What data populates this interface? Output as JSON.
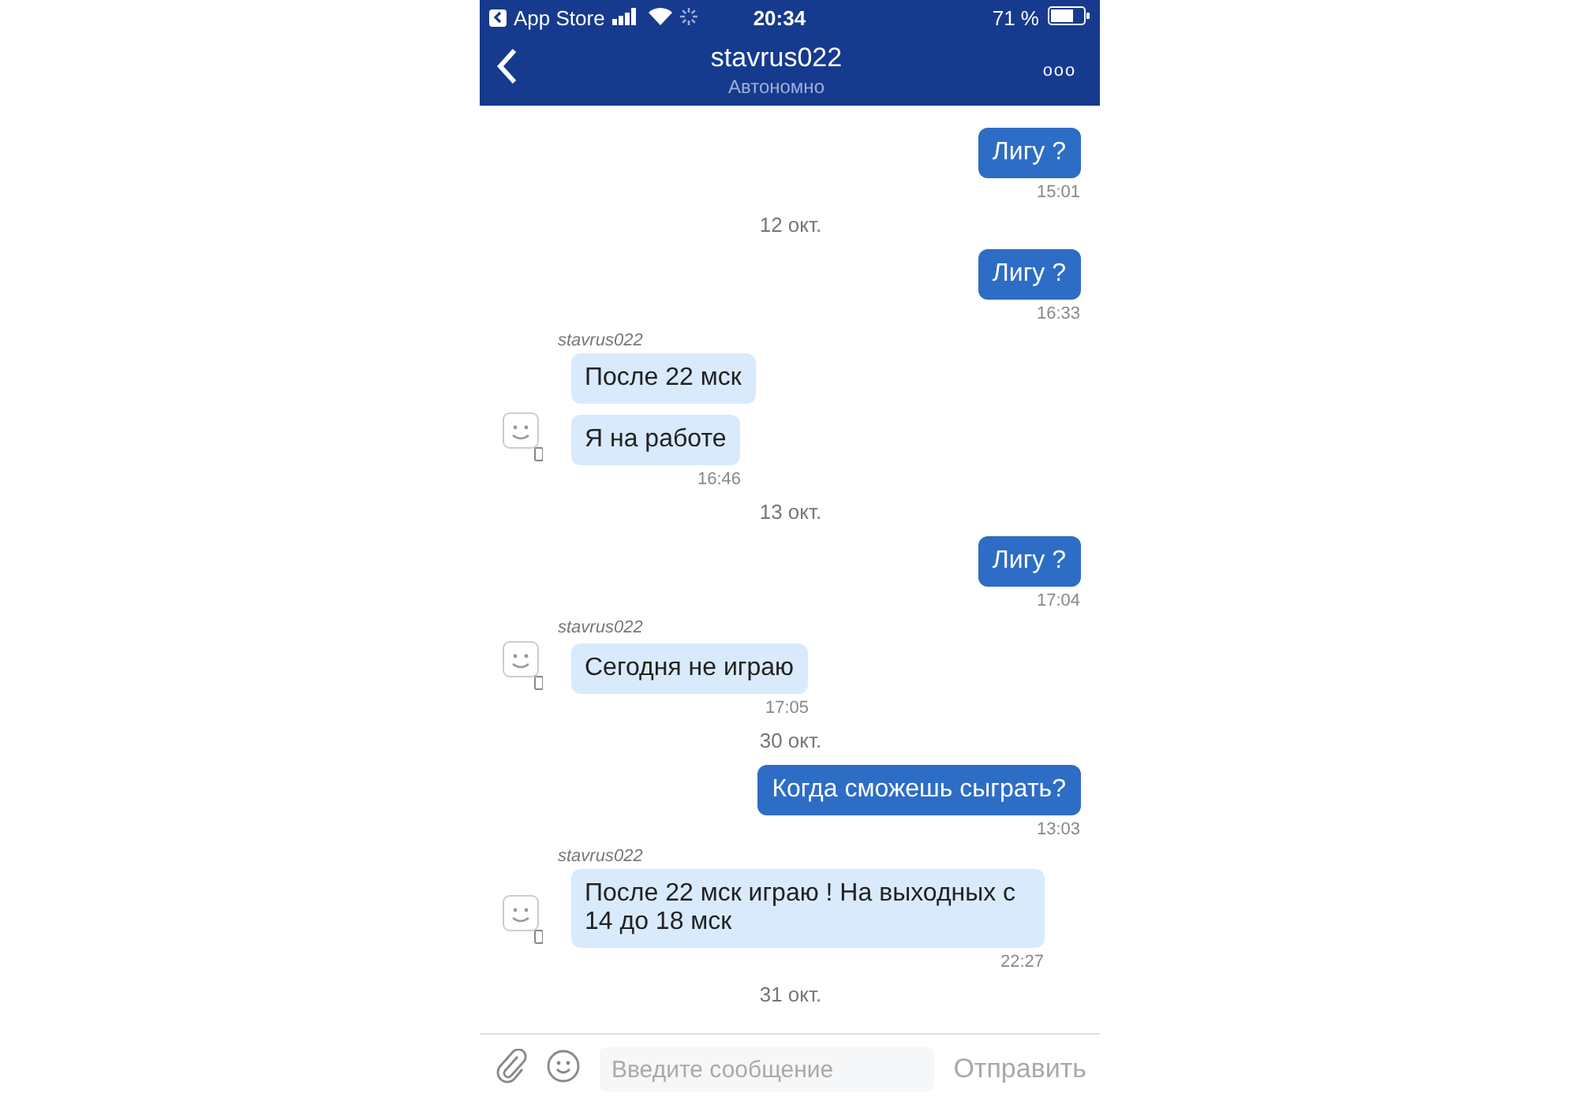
{
  "status_bar": {
    "back_app": "App Store",
    "time": "20:34",
    "battery": "71 %"
  },
  "header": {
    "title": "stavrus022",
    "subtitle": "Автономно",
    "menu": "ooo"
  },
  "messages": [
    {
      "kind": "out",
      "texts": [
        "Лигу ?"
      ],
      "time": "15:01"
    },
    {
      "kind": "date",
      "text": "12 окт."
    },
    {
      "kind": "out",
      "texts": [
        "Лигу ?"
      ],
      "time": "16:33"
    },
    {
      "kind": "in",
      "sender": "stavrus022",
      "texts": [
        "После 22 мск",
        "Я на работе"
      ],
      "time": "16:46"
    },
    {
      "kind": "date",
      "text": "13 окт."
    },
    {
      "kind": "out",
      "texts": [
        "Лигу ?"
      ],
      "time": "17:04"
    },
    {
      "kind": "in",
      "sender": "stavrus022",
      "texts": [
        "Сегодня не играю"
      ],
      "time": "17:05"
    },
    {
      "kind": "date",
      "text": "30 окт."
    },
    {
      "kind": "out",
      "texts": [
        "Когда сможешь сыграть?"
      ],
      "time": "13:03"
    },
    {
      "kind": "in",
      "sender": "stavrus022",
      "texts": [
        "После 22 мск играю ! На выходных с 14 до 18 мск"
      ],
      "time": "22:27"
    },
    {
      "kind": "date",
      "text": "31 окт."
    }
  ],
  "composer": {
    "placeholder": "Введите сообщение",
    "send": "Отправить"
  }
}
